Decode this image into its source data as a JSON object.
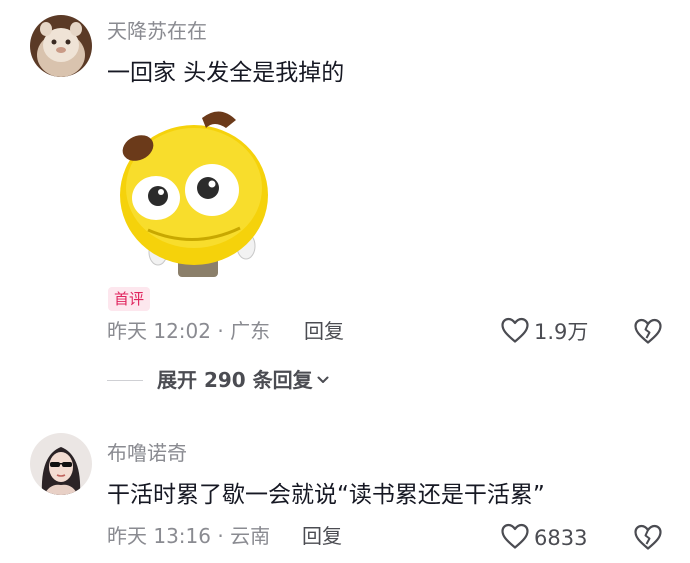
{
  "comments": [
    {
      "username": "天降苏在在",
      "text": "一回家 头发全是我掉的",
      "badge": "首评",
      "meta": "昨天 12:02 · 广东",
      "reply_label": "回复",
      "likes": "1.9万",
      "expand_label": "展开 290 条回复"
    },
    {
      "username": "布噜诺奇",
      "text": "干活时累了歇一会就说“读书累还是干活累”",
      "meta": "昨天 13:16 · 云南",
      "reply_label": "回复",
      "likes": "6833"
    }
  ],
  "icons": {
    "like": "heart-outline-icon",
    "dislike": "broken-heart-icon",
    "expand": "chevron-down-icon"
  },
  "colors": {
    "badge_text": "#e0245e",
    "badge_bg": "#fde7ee",
    "secondary_text": "#8a8b91",
    "primary_text": "#161823"
  }
}
